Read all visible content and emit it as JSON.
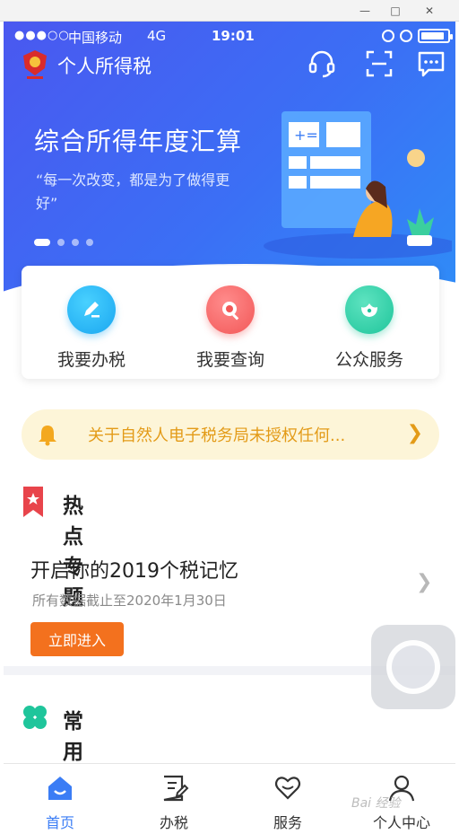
{
  "status_bar": {
    "signal": "●●●○○",
    "carrier": "中国移动",
    "network": "4G",
    "time": "19:01",
    "battery_level": 0.9
  },
  "header": {
    "title": "个人所得税",
    "icons": [
      "emblem-icon",
      "customer-service-icon",
      "scan-icon",
      "message-icon"
    ]
  },
  "banner": {
    "title": "综合所得年度汇算",
    "subtitle": "“每一次改变，都是为了做得更好”",
    "slide_count": 4,
    "active_slide": 1
  },
  "actions": [
    {
      "label": "我要办税",
      "icon": "edit-icon",
      "color": "#1aa6f0"
    },
    {
      "label": "我要查询",
      "icon": "search-icon",
      "color": "#f25757"
    },
    {
      "label": "公众服务",
      "icon": "lotus-icon",
      "color": "#1fc59b"
    }
  ],
  "notice": {
    "text": "关于自然人电子税务局未授权任何...",
    "color": "#e39b18"
  },
  "hot_topics": {
    "title": "热点专题",
    "item_title": "开启你的2019个税记忆",
    "item_sub": "所有数据截止至2020年1月30日",
    "button": "立即进入"
  },
  "common_services": {
    "title": "常用业务"
  },
  "tabbar": {
    "tabs": [
      {
        "label": "首页",
        "icon": "home-icon",
        "active": true
      },
      {
        "label": "办税",
        "icon": "tax-form-icon",
        "active": false
      },
      {
        "label": "服务",
        "icon": "service-heart-icon",
        "active": false
      },
      {
        "label": "个人中心",
        "icon": "user-icon",
        "active": false
      }
    ],
    "active_color": "#3b7df5"
  },
  "watermark": "Bai 经验"
}
